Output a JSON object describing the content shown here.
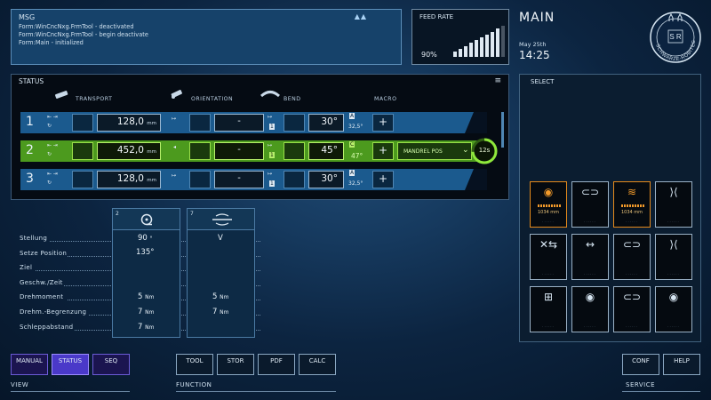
{
  "msg": {
    "title": "MSG",
    "lines": [
      "Form:WinCncNxg.FrmTool - deactivated",
      "Form:WinCncNxg.FrmTool - begin deactivate",
      "Form:Main - initialized"
    ],
    "arrows": "▲▲"
  },
  "feed": {
    "title": "FEED RATE",
    "percent": "90%",
    "level": 0.9
  },
  "header": {
    "title": "MAIN",
    "date": "May 25th",
    "time": "14:25"
  },
  "logo": {
    "text": "SCHWARZE-ROBITEC",
    "mono": "S R"
  },
  "status": {
    "title": "STATUS",
    "menu_icon": "menu-icon",
    "columns": {
      "transport": "TRANSPORT",
      "orientation": "ORIENTATION",
      "bend": "BEND",
      "macro": "MACRO"
    },
    "rows": [
      {
        "num": "1",
        "transport": "128,0",
        "transport_unit": "mm",
        "orientation": "-",
        "bend": "30°",
        "bend_small": "32,5°",
        "bend_letter": "A",
        "macro": "+"
      },
      {
        "num": "2",
        "transport": "452,0",
        "transport_unit": "mm",
        "orientation": "-",
        "bend": "45°",
        "bend_small": "47°",
        "bend_letter": "C",
        "macro": "+",
        "macro_label": "MANDREL POS",
        "timer": "12s"
      },
      {
        "num": "3",
        "transport": "128,0",
        "transport_unit": "mm",
        "orientation": "-",
        "bend": "30°",
        "bend_small": "32,5°",
        "bend_letter": "A",
        "macro": "+"
      }
    ],
    "one": "1"
  },
  "details": {
    "labels": [
      "Stellung",
      "Setze Position",
      "Ziel",
      "Geschw./Zeit",
      "Drehmoment",
      "Drehm.-Begrenzung",
      "Schleppabstand"
    ],
    "card1": {
      "num": "2",
      "stellung": "90",
      "stellung_unit": "°",
      "setze": "135°",
      "drehmoment": "5",
      "drehmoment_unit": "Nm",
      "begrenzung": "7",
      "begrenzung_unit": "Nm",
      "schlepp": "7",
      "schlepp_unit": "Nm"
    },
    "card2": {
      "num": "7",
      "stellung": "V",
      "drehmoment": "5",
      "drehmoment_unit": "Nm",
      "begrenzung": "7",
      "begrenzung_unit": "Nm"
    }
  },
  "select": {
    "title": "SELECT",
    "tiles": [
      {
        "value": "1034 mm",
        "sub": "......"
      },
      {
        "value": "",
        "sub": "......"
      },
      {
        "value": "1034 mm",
        "sub": "......"
      },
      {
        "value": "",
        "sub": "......"
      },
      {
        "value": "",
        "sub": "......"
      },
      {
        "value": "",
        "sub": "......"
      },
      {
        "value": "",
        "sub": "......"
      },
      {
        "value": "",
        "sub": "......"
      },
      {
        "value": "",
        "sub": "......"
      },
      {
        "value": "",
        "sub": "......"
      },
      {
        "value": "",
        "sub": "......"
      },
      {
        "value": "",
        "sub": "......"
      }
    ]
  },
  "bottom": {
    "view": {
      "label": "VIEW",
      "buttons": [
        "MANUAL",
        "STATUS",
        "SEQ"
      ]
    },
    "function": {
      "label": "FUNCTION",
      "buttons": [
        "TOOL",
        "STOR",
        "PDF",
        "CALC"
      ]
    },
    "service": {
      "label": "SERVICE",
      "buttons": [
        "CONF",
        "HELP"
      ]
    }
  },
  "colors": {
    "accent": "#4a39c9",
    "active_row": "#4c9a1e",
    "row": "#1b5a8e",
    "orange": "#e58a1c"
  }
}
